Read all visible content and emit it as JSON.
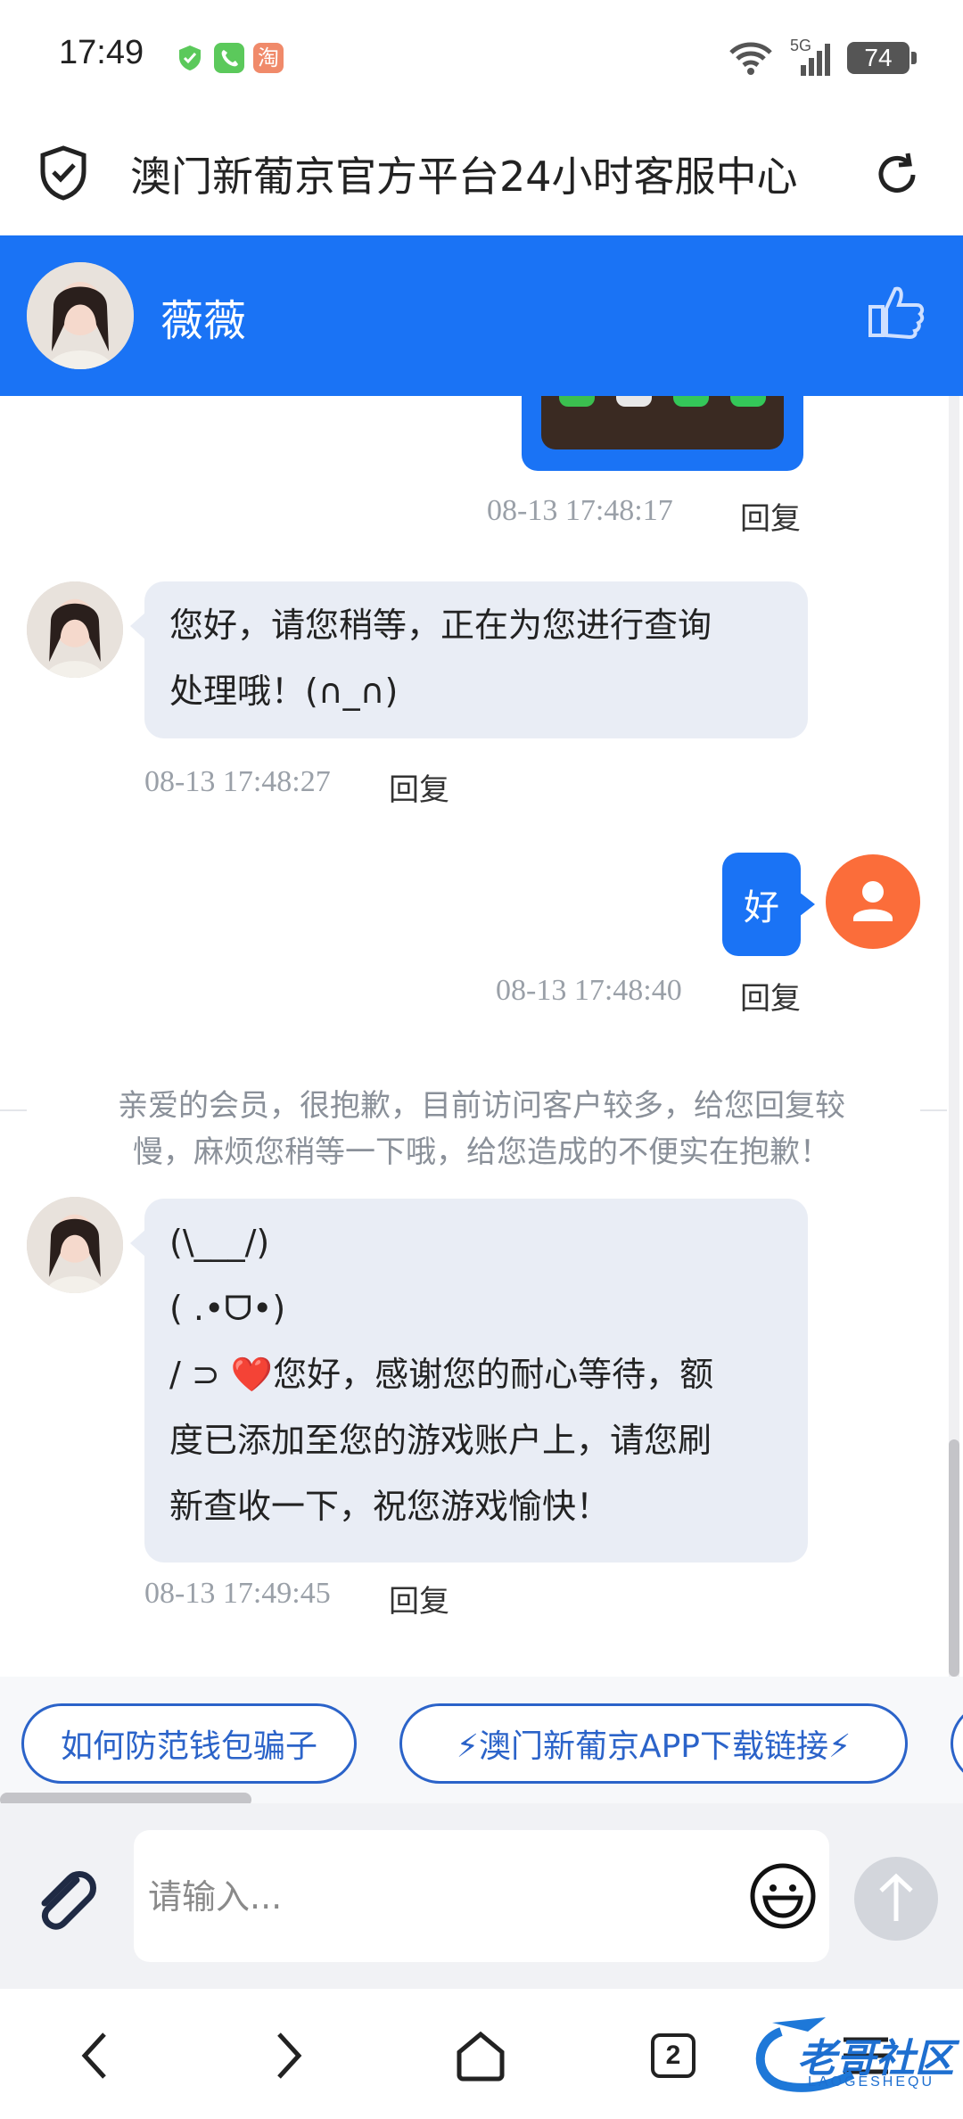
{
  "status_bar": {
    "time": "17:49",
    "battery": "74",
    "network": "5G"
  },
  "titlebar": {
    "title": "澳门新葡京官方平台24小时客服中心"
  },
  "header": {
    "agent_name": "薇薇"
  },
  "messages": {
    "m0": {
      "time": "08-13 17:48:17",
      "reply": "回复"
    },
    "m1": {
      "line1": "您好，请您稍等，正在为您进行查询",
      "line2": "处理哦！(∩_∩)",
      "time": "08-13 17:48:27",
      "reply": "回复"
    },
    "m2": {
      "text": "好",
      "time": "08-13 17:48:40",
      "reply": "回复"
    },
    "notice": {
      "line1": "亲爱的会员，很抱歉，目前访问客户较多，给您回复较",
      "line2": "慢，麻烦您稍等一下哦，给您造成的不便实在抱歉！"
    },
    "m3": {
      "line1": "(\\___/)",
      "line2": "( .•ᗜ•)",
      "line3_prefix": "/ ⊃ ",
      "line3_heart": "❤️",
      "line3_text": "您好，感谢您的耐心等待，额",
      "line4": "度已添加至您的游戏账户上，请您刷",
      "line5": "新查收一下，祝您游戏愉快！",
      "time": "08-13 17:49:45",
      "reply": "回复"
    }
  },
  "quick_replies": [
    "如何防范钱包骗子",
    "⚡澳门新葡京APP下载链接⚡"
  ],
  "input": {
    "placeholder": "请输入..."
  },
  "nav": {
    "tab_count": "2"
  },
  "watermark": {
    "text": "老哥社区",
    "subtext": "LAOGESHEQU"
  },
  "colors": {
    "accent": "#1a73f5",
    "user_avatar": "#fb6d3a",
    "chip": "#2b63c9"
  }
}
